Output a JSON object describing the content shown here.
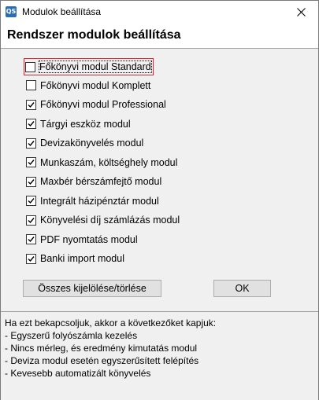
{
  "window": {
    "title": "Modulok beállítása",
    "icon_name": "app-icon",
    "icon_text": "QS"
  },
  "header": {
    "title": "Rendszer modulok beállítása"
  },
  "modules": [
    {
      "label": "Főkönyvi modul Standard",
      "checked": false,
      "focused": true
    },
    {
      "label": "Főkönyvi modul Komplett",
      "checked": false
    },
    {
      "label": "Főkönyvi modul Professional",
      "checked": true
    },
    {
      "label": "Tárgyi eszköz modul",
      "checked": true
    },
    {
      "label": "Devizakönyvelés modul",
      "checked": true
    },
    {
      "label": "Munkaszám, költséghely modul",
      "checked": true
    },
    {
      "label": "Maxbér bérszámfejtő modul",
      "checked": true
    },
    {
      "label": "Integrált házipénztár modul",
      "checked": true
    },
    {
      "label": "Könyvelési díj számlázás modul",
      "checked": true
    },
    {
      "label": "PDF nyomtatás modul",
      "checked": true
    },
    {
      "label": "Banki import modul",
      "checked": true
    }
  ],
  "buttons": {
    "select_all": "Összes kijelölése/törlése",
    "ok": "OK"
  },
  "info": {
    "lines": [
      "Ha ezt bekapcsoljuk, akkor a következőket kapjuk:",
      "- Egyszerű folyószámla kezelés",
      "- Nincs mérleg, és eredmény kimutatás modul",
      "- Deviza modul esetén egyszerűsített felépítés",
      "- Kevesebb automatizált könyvelés"
    ]
  },
  "colors": {
    "focus_border": "#d9242f",
    "window_bg": "#f0f0f0",
    "app_icon": "#2b6cb5"
  }
}
